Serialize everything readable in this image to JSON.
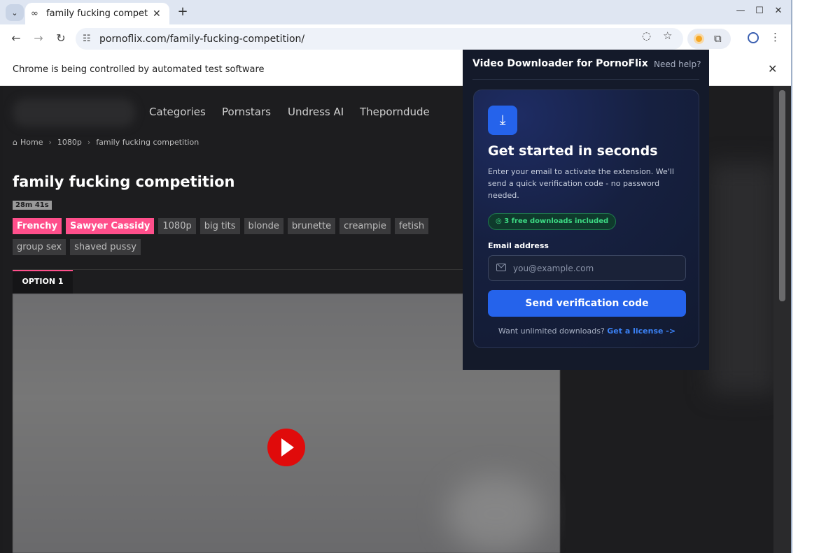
{
  "browser": {
    "tab_title": "family fucking competitio",
    "tab_favicon": "∞",
    "tab_dropdown": "⌄",
    "url": "pornoflix.com/family-fucking-competition/",
    "infobar_text": "Chrome is being controlled by automated test software"
  },
  "site": {
    "nav": [
      "Categories",
      "Pornstars",
      "Undress AI",
      "Theporndude"
    ],
    "breadcrumb": [
      "Home",
      "1080p",
      "family fucking competition"
    ],
    "title": "family fucking competition",
    "duration": "28m 41s",
    "tags_highlight": [
      "Frenchy",
      "Sawyer Cassidy"
    ],
    "tags": [
      "1080p",
      "big tits",
      "blonde",
      "brunette",
      "creampie",
      "fetish",
      "group sex",
      "shaved pussy"
    ],
    "option_tab": "OPTION 1"
  },
  "popup": {
    "header": "Video Downloader for PornoFlix",
    "help": "Need help?",
    "card_title": "Get started in seconds",
    "description": "Enter your email to activate the extension. We'll send a quick verification code - no password needed.",
    "badge": "3 free downloads included",
    "email_label": "Email address",
    "email_placeholder": "you@example.com",
    "send_button": "Send verification code",
    "license_prompt": "Want unlimited downloads?",
    "license_link": "Get a license ->"
  },
  "colors": {
    "accent_pink": "#ff4f8b",
    "accent_blue": "#2563eb",
    "success_green": "#3ddc84",
    "play_red": "#e00b0b"
  }
}
